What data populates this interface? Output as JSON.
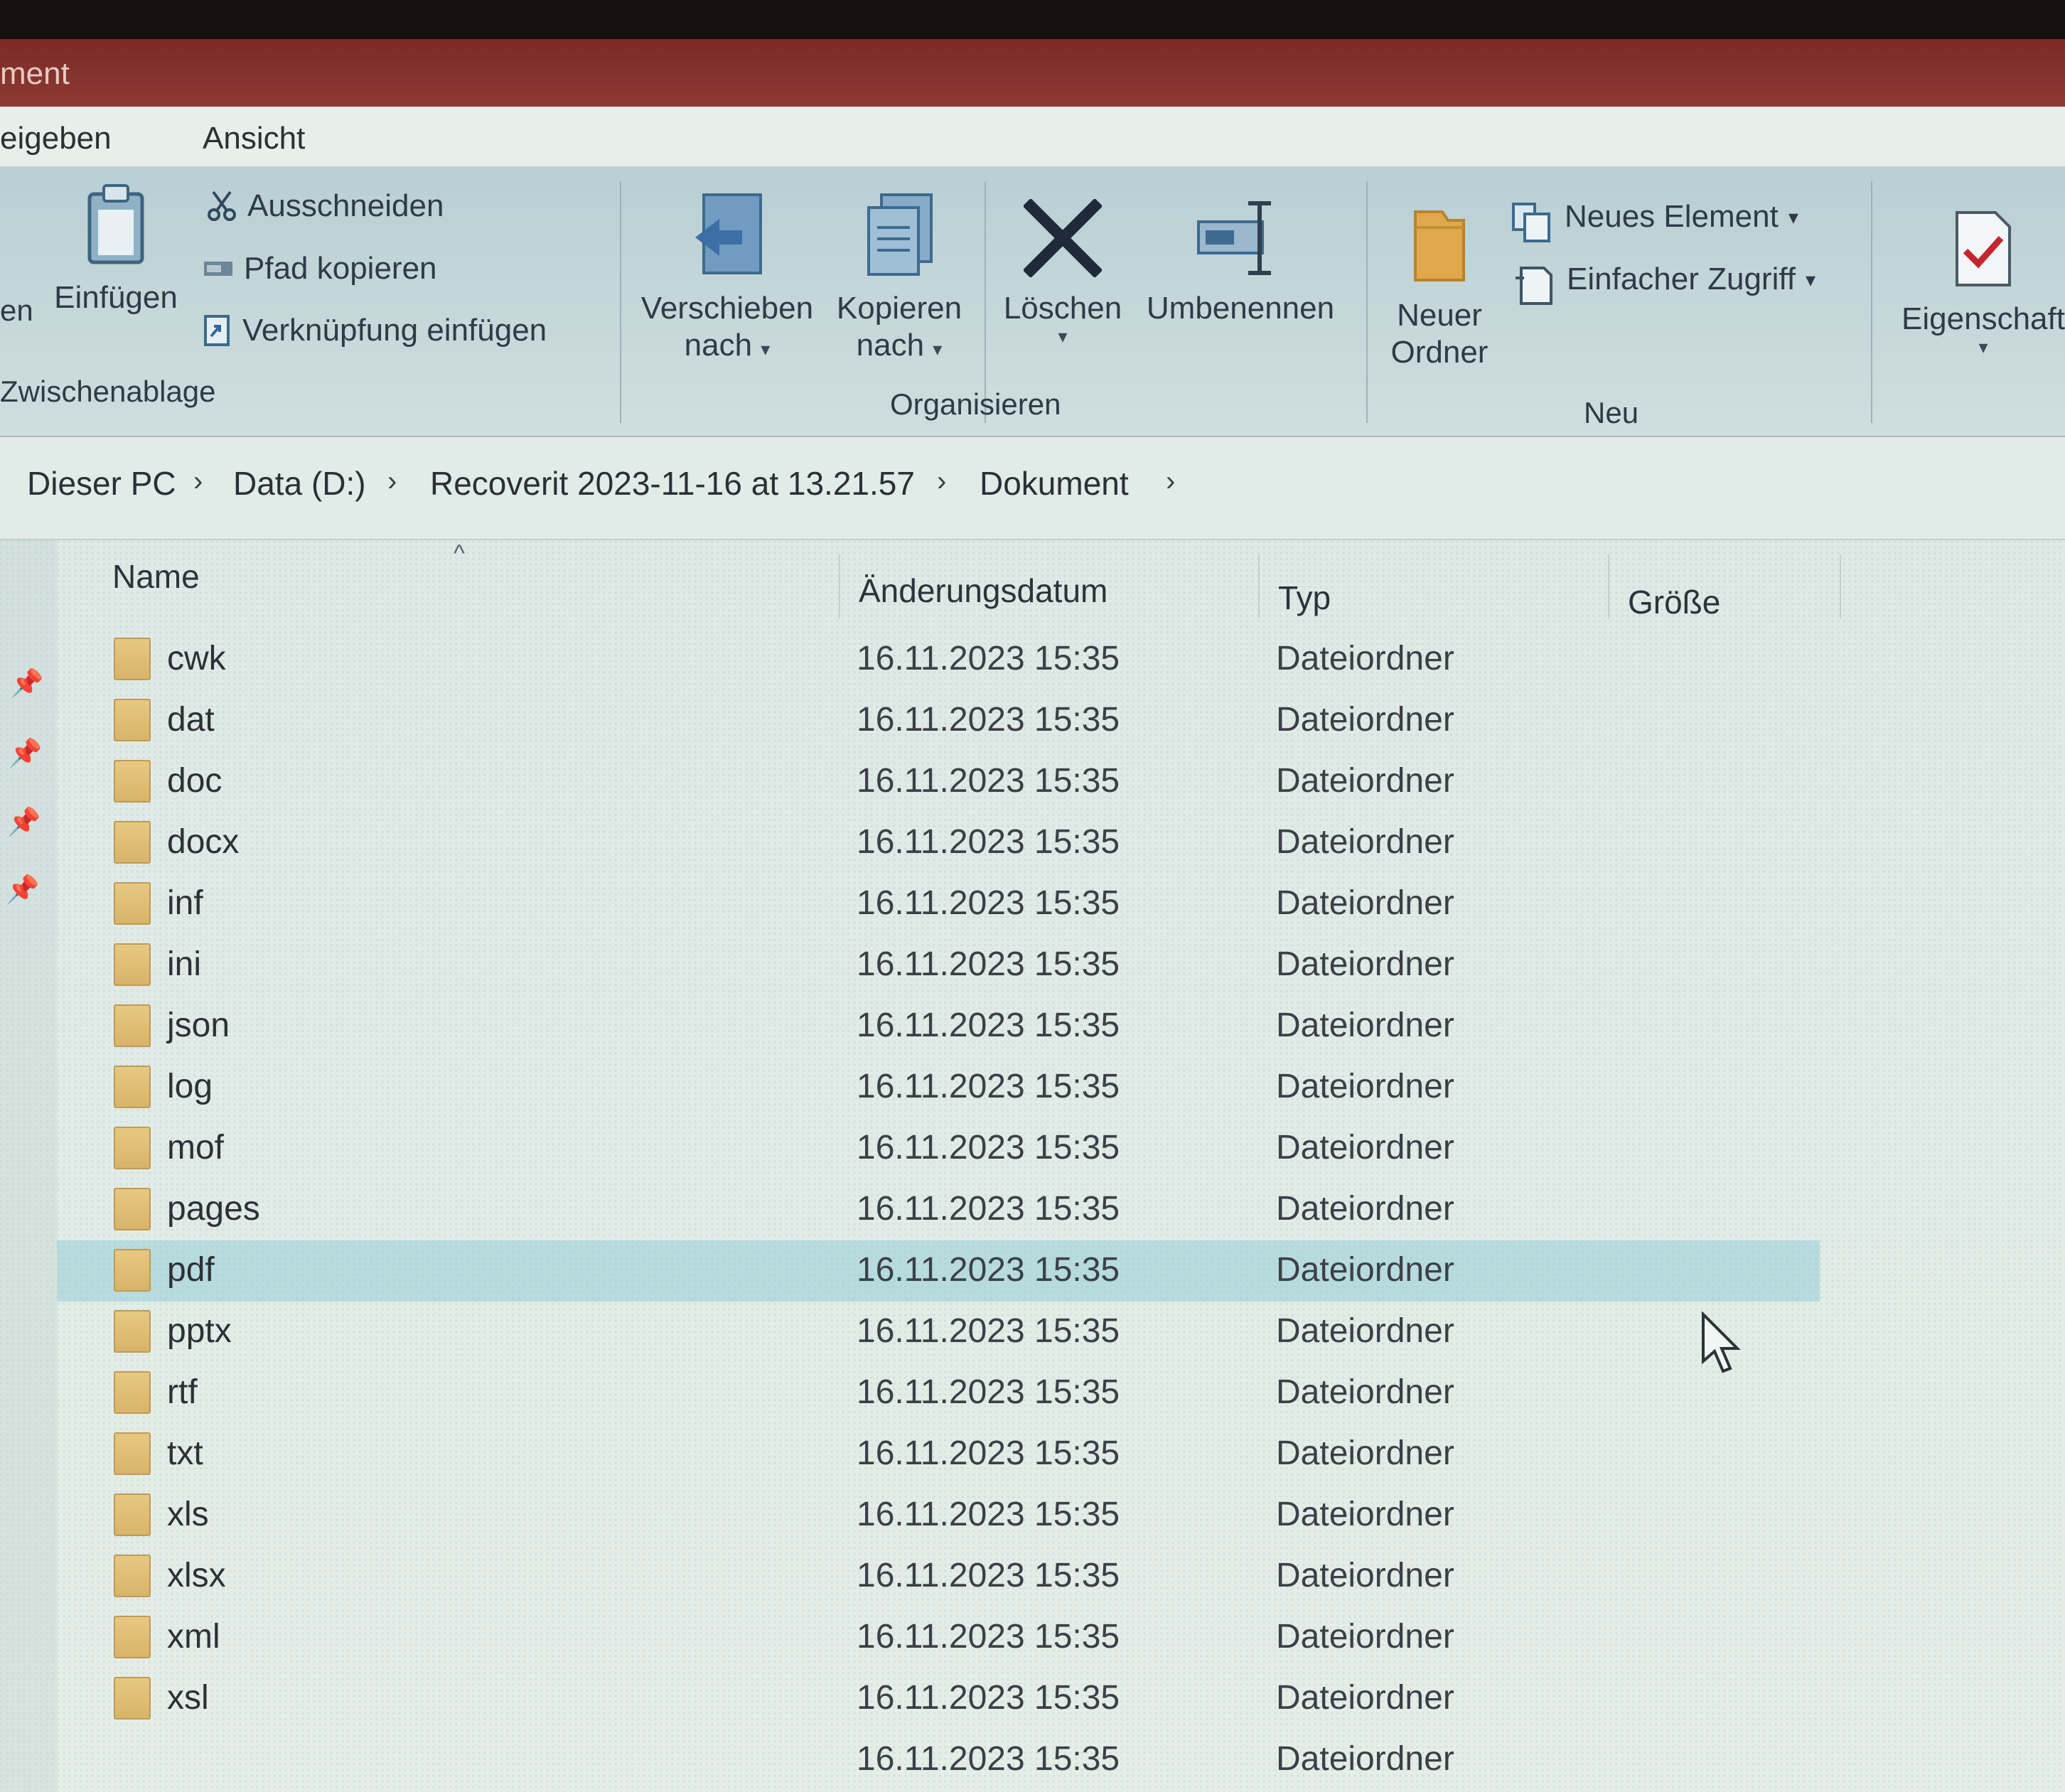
{
  "title": {
    "text": "ment"
  },
  "ribbon_tabs": [
    "eigeben",
    "Ansicht"
  ],
  "ribbon": {
    "clipboard": {
      "cut_partial_label": "en",
      "paste_label": "Einfügen",
      "cut_label": "Ausschneiden",
      "copy_path_label": "Pfad kopieren",
      "paste_shortcut_label": "Verknüpfung einfügen",
      "group_label": "Zwischenablage"
    },
    "organize": {
      "move_to_line1": "Verschieben",
      "move_to_line2": "nach",
      "copy_to_line1": "Kopieren",
      "copy_to_line2": "nach",
      "delete_label": "Löschen",
      "rename_label": "Umbenennen",
      "group_label": "Organisieren"
    },
    "new": {
      "new_folder_line1": "Neuer",
      "new_folder_line2": "Ordner",
      "new_item_label": "Neues Element",
      "easy_access_label": "Einfacher Zugriff",
      "group_label": "Neu"
    },
    "open": {
      "properties_label": "Eigenschaft"
    }
  },
  "breadcrumb": [
    "Dieser PC",
    "Data (D:)",
    "Recoverit 2023-11-16 at 13.21.57",
    "Dokument"
  ],
  "columns": {
    "name": "Name",
    "date": "Änderungsdatum",
    "type": "Typ",
    "size": "Größe"
  },
  "files": [
    {
      "name": "cwk",
      "date": "16.11.2023 15:35",
      "type": "Dateiordner"
    },
    {
      "name": "dat",
      "date": "16.11.2023 15:35",
      "type": "Dateiordner"
    },
    {
      "name": "doc",
      "date": "16.11.2023 15:35",
      "type": "Dateiordner"
    },
    {
      "name": "docx",
      "date": "16.11.2023 15:35",
      "type": "Dateiordner"
    },
    {
      "name": "inf",
      "date": "16.11.2023 15:35",
      "type": "Dateiordner"
    },
    {
      "name": "ini",
      "date": "16.11.2023 15:35",
      "type": "Dateiordner"
    },
    {
      "name": "json",
      "date": "16.11.2023 15:35",
      "type": "Dateiordner"
    },
    {
      "name": "log",
      "date": "16.11.2023 15:35",
      "type": "Dateiordner"
    },
    {
      "name": "mof",
      "date": "16.11.2023 15:35",
      "type": "Dateiordner"
    },
    {
      "name": "pages",
      "date": "16.11.2023 15:35",
      "type": "Dateiordner"
    },
    {
      "name": "pdf",
      "date": "16.11.2023 15:35",
      "type": "Dateiordner",
      "selected": true
    },
    {
      "name": "pptx",
      "date": "16.11.2023 15:35",
      "type": "Dateiordner"
    },
    {
      "name": "rtf",
      "date": "16.11.2023 15:35",
      "type": "Dateiordner"
    },
    {
      "name": "txt",
      "date": "16.11.2023 15:35",
      "type": "Dateiordner"
    },
    {
      "name": "xls",
      "date": "16.11.2023 15:35",
      "type": "Dateiordner"
    },
    {
      "name": "xlsx",
      "date": "16.11.2023 15:35",
      "type": "Dateiordner"
    },
    {
      "name": "xml",
      "date": "16.11.2023 15:35",
      "type": "Dateiordner"
    },
    {
      "name": "xsl",
      "date": "16.11.2023 15:35",
      "type": "Dateiordner"
    },
    {
      "name": "",
      "date": "16.11.2023 15:35",
      "type": "Dateiordner"
    }
  ],
  "colors": {
    "titlebar": "#8e3a33",
    "ribbon": "#c7d8da",
    "folder": "#d8b46a",
    "selection": "#96cdd7",
    "delete_icon": "#1f2a3a"
  }
}
